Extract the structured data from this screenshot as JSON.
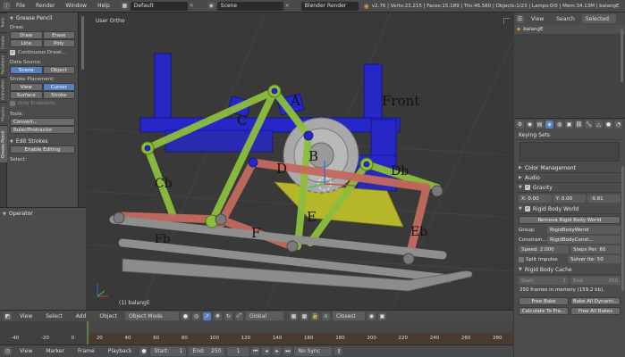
{
  "topbar": {
    "menus": [
      "File",
      "Render",
      "Window",
      "Help"
    ],
    "layout": "Default",
    "scene": "Scene",
    "engine": "Blender Render",
    "stats": "v2.76 | Verts:23,215 | Faces:15,189 | Tris:46,560 | Objects:1/23 | Lamps:0/0 | Mem:34.13M | balangE"
  },
  "tooltabs": [
    "Tools",
    "Create",
    "Relations",
    "Animation",
    "Physics",
    "Grease Pencil"
  ],
  "toolshelf": {
    "title": "Grease Pencil",
    "draw_label": "Draw:",
    "draw": "Draw",
    "erase": "Erase",
    "line": "Line",
    "poly": "Poly",
    "continuous": "Continuous Drawi...",
    "data_source_label": "Data Source:",
    "scene": "Scene",
    "object": "Object",
    "stroke_placement_label": "Stroke Placement:",
    "view": "View",
    "cursor": "Cursor",
    "surface": "Surface",
    "stroke": "Stroke",
    "only_endpoints": "Only Endpoints",
    "tools_label": "Tools:",
    "convert": "Convert...",
    "ruler": "Ruler/Protractor",
    "edit_strokes": "Edit Strokes",
    "enable_editing": "Enable Editing",
    "select_label": "Select:"
  },
  "operator": {
    "title": "Operator"
  },
  "viewport": {
    "view_label": "User Ortho",
    "object_label": "(1) balangE",
    "annotations": [
      "A",
      "Front",
      "C",
      "B",
      "D",
      "Db",
      "Cb",
      "E",
      "F",
      "Fb",
      "Eb"
    ]
  },
  "vp_header": {
    "menus": [
      "View",
      "Select",
      "Add",
      "Object"
    ],
    "mode": "Object Mode",
    "orientation": "Global",
    "snap": "Closest"
  },
  "timeline": {
    "ticks": [
      "-40",
      "-20",
      "0",
      "20",
      "40",
      "60",
      "80",
      "100",
      "120",
      "140",
      "160",
      "180",
      "200",
      "220",
      "240",
      "260",
      "280"
    ],
    "menus": [
      "View",
      "Marker",
      "Frame",
      "Playback"
    ],
    "start": "Start:",
    "start_val": "1",
    "end": "End:",
    "end_val": "250",
    "current": "1",
    "sync": "No Sync"
  },
  "outliner": {
    "tabs": [
      "View",
      "Search",
      "Selected"
    ],
    "item": "balangE"
  },
  "props": {
    "keying_sets": "Keying Sets",
    "color_management": "Color Management",
    "audio": "Audio",
    "gravity": "Gravity",
    "gx": "X: 0.00",
    "gy": "Y: 0.00",
    "gz": "-9.81",
    "rbw": "Rigid Body World",
    "remove_rbw": "Remove Rigid Body World",
    "group_label": "Group:",
    "group_val": "RigidBodyWorld",
    "constr_label": "Constrain...",
    "constr_val": "RigidBodyConst...",
    "speed": "Speed: 2.000",
    "steps": "Steps Per: 60",
    "split": "Split Impulse",
    "solver": "Solver Ite: 50",
    "cache": "Rigid Body Cache",
    "cache_start": "Start:",
    "cache_start_val": "1",
    "cache_end": "End:",
    "cache_end_val": "250",
    "cache_info": "250 frames in memory (159.2 kb).",
    "free_bake": "Free Bake",
    "bake_all": "Bake All Dynami...",
    "calc_to_frame": "Calculate To Fra...",
    "free_all": "Free All Bakes"
  },
  "colors": {
    "blue": "#2020c8",
    "green": "#8cbe3c",
    "salmon": "#c46a5e",
    "gray": "#8e8e8e",
    "yellow": "#b6b62a",
    "accent": "#5680c2"
  }
}
